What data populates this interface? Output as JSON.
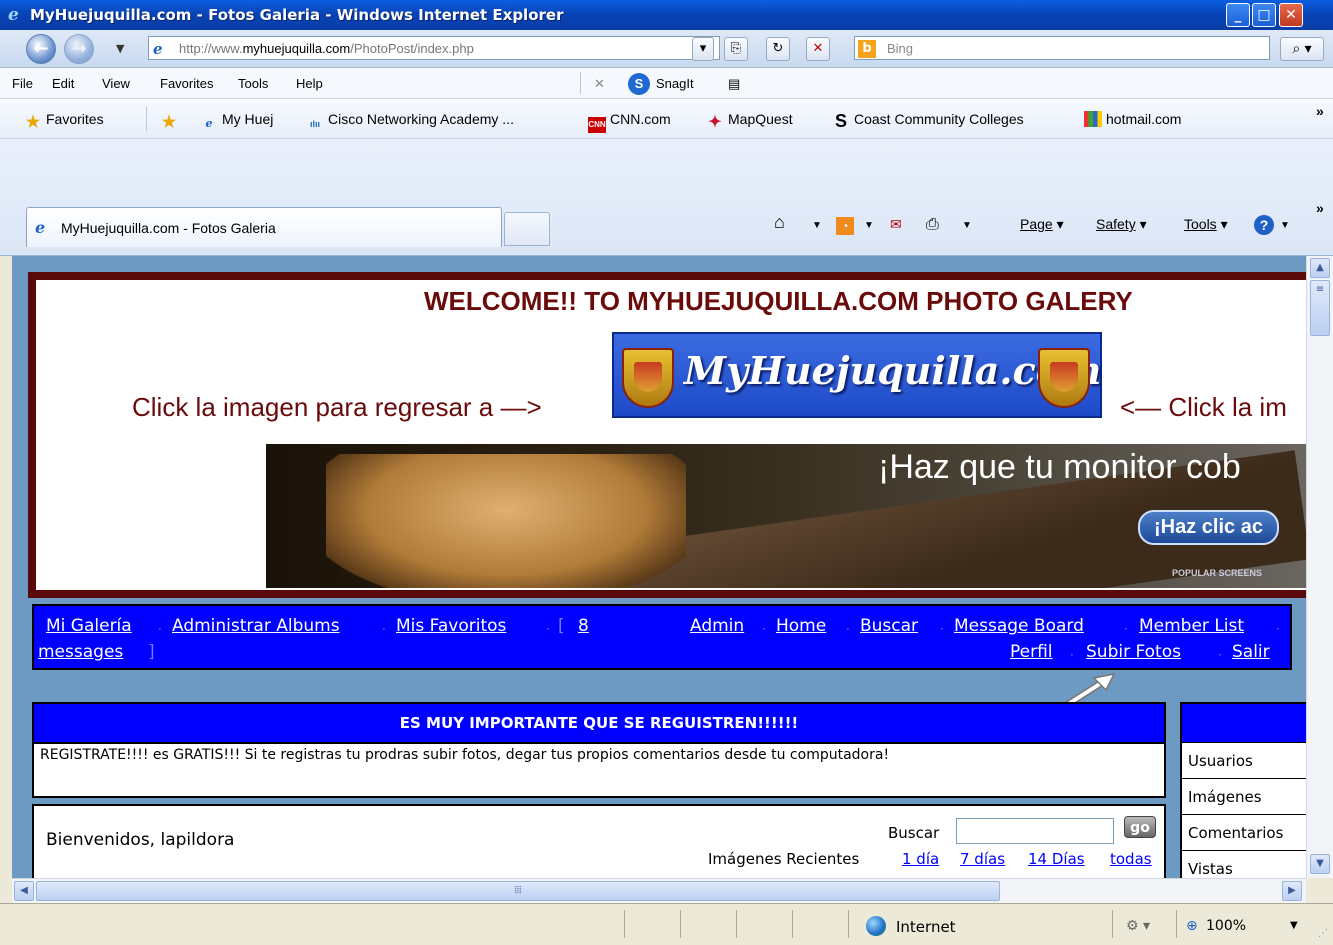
{
  "window": {
    "title": "MyHuejuquilla.com - Fotos Galeria - Windows Internet Explorer"
  },
  "address": {
    "url_prefix": "http://www.",
    "url_domain": "myhuejuquilla.com",
    "url_path": "/PhotoPost/index.php",
    "search_placeholder": "Bing"
  },
  "menu": {
    "items": [
      "File",
      "Edit",
      "View",
      "Favorites",
      "Tools",
      "Help"
    ],
    "snagit": "SnagIt"
  },
  "favorites": {
    "label": "Favorites",
    "items": [
      "My Huej",
      "Cisco Networking Academy ...",
      "CNN.com",
      "MapQuest",
      "Coast Community Colleges",
      "hotmail.com"
    ],
    "more": "»"
  },
  "tab": {
    "title": "MyHuejuquilla.com - Fotos Galeria",
    "commands": [
      "Page",
      "Safety",
      "Tools"
    ],
    "more": "»"
  },
  "page": {
    "welcome": "WELCOME!! TO MYHUEJUQUILLA.COM PHOTO GALERY",
    "logo_text": "MyHuejuquilla.com",
    "click_left": "Click la imagen para regresar a —>",
    "click_right": "<— Click la im",
    "ad_headline": "¡Haz que tu monitor cob",
    "ad_cta": "¡Haz clic ac",
    "ad_brand": "POPULAR SCREENS",
    "nav_left": [
      "Mi Galería",
      "Administrar Albums",
      "Mis Favoritos"
    ],
    "nav_messages_count": "8",
    "nav_messages_label": "messages",
    "nav_right_row1": [
      "Admin",
      "Home",
      "Buscar",
      "Message Board",
      "Member List"
    ],
    "nav_right_row2": [
      "Perfil",
      "Subir Fotos",
      "Salir"
    ],
    "reg_heading": "ES MUY IMPORTANTE QUE SE REGUISTREN!!!!!!",
    "reg_text": "REGISTRATE!!!! es GRATIS!!! Si te registras tu prodras subir fotos, degar tus propios comentarios desde tu computadora!",
    "greeting": "Bienvenidos, lapildora",
    "search_label": "Buscar",
    "search_go": "go",
    "recent_label": "Imágenes Recientes",
    "recent_links": [
      "1 día",
      "7 días",
      "14 Días",
      "todas"
    ],
    "stats": [
      "Usuarios",
      "Imágenes",
      "Comentarios",
      "Vistas"
    ]
  },
  "status": {
    "zone": "Internet",
    "zoom": "100%"
  }
}
